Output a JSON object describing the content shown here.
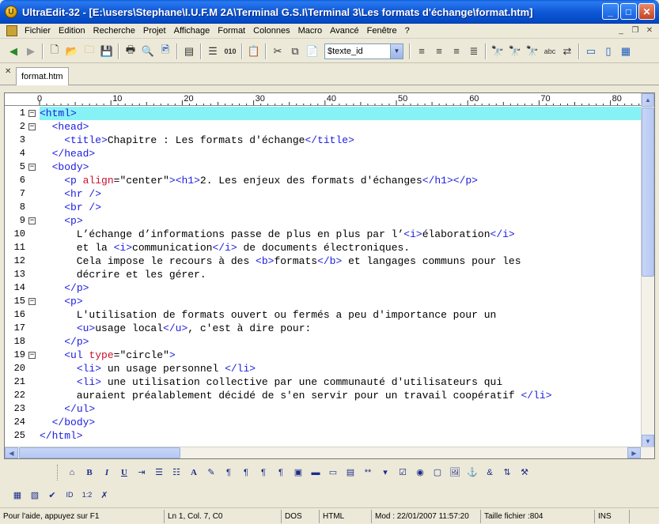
{
  "window": {
    "title": "UltraEdit-32 - [E:\\users\\Stephane\\I.U.F.M 2A\\Terminal G.S.I\\Terminal 3\\Les formats d'échange\\format.htm]"
  },
  "menu": [
    "Fichier",
    "Edition",
    "Recherche",
    "Projet",
    "Affichage",
    "Format",
    "Colonnes",
    "Macro",
    "Avancé",
    "Fenêtre",
    "?"
  ],
  "toolbar": {
    "function_combo_value": "$texte_id"
  },
  "tabs": [
    {
      "label": "format.htm",
      "active": true
    }
  ],
  "ruler": {
    "labels": [
      "0",
      "10",
      "20",
      "30",
      "40",
      "50",
      "60",
      "70",
      "80"
    ]
  },
  "editor": {
    "current_line": 1,
    "lines": [
      {
        "n": "1",
        "fold": "−",
        "text": "<html>"
      },
      {
        "n": "2",
        "fold": "−",
        "text": "  <head>"
      },
      {
        "n": "3",
        "fold": "",
        "text": "    <title>Chapitre : Les formats d'échange</title>"
      },
      {
        "n": "4",
        "fold": "",
        "text": "  </head>"
      },
      {
        "n": "5",
        "fold": "−",
        "text": "  <body>"
      },
      {
        "n": "6",
        "fold": "",
        "text": "    <p align=\"center\"><h1>2. Les enjeux des formats d'échanges</h1></p>"
      },
      {
        "n": "7",
        "fold": "",
        "text": "    <hr />"
      },
      {
        "n": "8",
        "fold": "",
        "text": "    <br />"
      },
      {
        "n": "9",
        "fold": "−",
        "text": "    <p>"
      },
      {
        "n": "10",
        "fold": "",
        "text": "      L’échange d’informations passe de plus en plus par l’<i>élaboration</i>"
      },
      {
        "n": "11",
        "fold": "",
        "text": "      et la <i>communication</i> de documents électroniques."
      },
      {
        "n": "12",
        "fold": "",
        "text": "      Cela impose le recours à des <b>formats</b> et langages communs pour les"
      },
      {
        "n": "13",
        "fold": "",
        "text": "      décrire et les gérer."
      },
      {
        "n": "14",
        "fold": "",
        "text": "    </p>"
      },
      {
        "n": "15",
        "fold": "−",
        "text": "    <p>"
      },
      {
        "n": "16",
        "fold": "",
        "text": "      L'utilisation de formats ouvert ou fermés a peu d'importance pour un"
      },
      {
        "n": "17",
        "fold": "",
        "text": "      <u>usage local</u>, c'est à dire pour:"
      },
      {
        "n": "18",
        "fold": "",
        "text": "    </p>"
      },
      {
        "n": "19",
        "fold": "−",
        "text": "    <ul type=\"circle\">"
      },
      {
        "n": "20",
        "fold": "",
        "text": "      <li> un usage personnel </li>"
      },
      {
        "n": "21",
        "fold": "",
        "text": "      <li> une utilisation collective par une communauté d'utilisateurs qui"
      },
      {
        "n": "22",
        "fold": "",
        "text": "      auraient préalablement décidé de s'en servir pour un travail coopératif </li>"
      },
      {
        "n": "23",
        "fold": "",
        "text": "    </ul>"
      },
      {
        "n": "24",
        "fold": "",
        "text": "  </body>"
      },
      {
        "n": "25",
        "fold": "",
        "text": "</html>"
      }
    ]
  },
  "status": {
    "help": "Pour l'aide, appuyez sur F1",
    "position": "Ln 1, Col. 7, C0",
    "line_endings": "DOS",
    "syntax": "HTML",
    "modified": "Mod : 22/01/2007 11:57:20",
    "file_size": "Taille fichier :804",
    "insert_mode": "INS"
  }
}
